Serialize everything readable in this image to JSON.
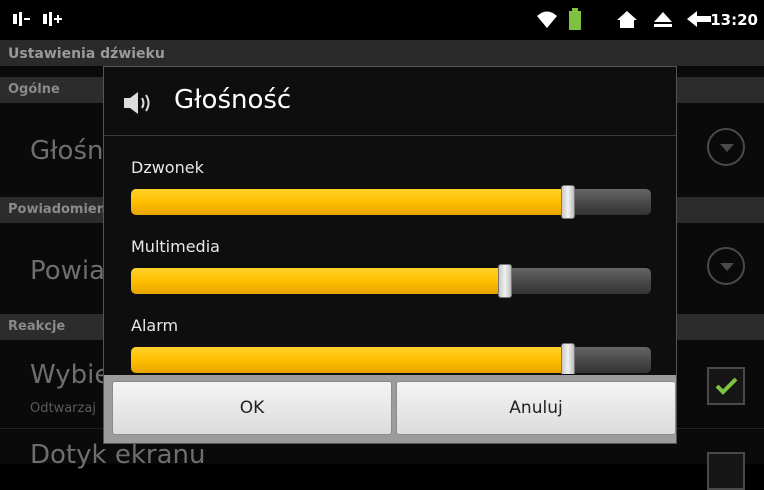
{
  "statusbar": {
    "time": "13:20"
  },
  "background": {
    "title": "Ustawienia dźwieku",
    "sections": [
      {
        "label": "Ogólne"
      },
      {
        "label": "Powiadomienia"
      },
      {
        "label": "Reakcje"
      }
    ],
    "items": [
      {
        "label": "Głośność"
      },
      {
        "label": "Powiadomienia"
      },
      {
        "label": "Wybieranie numeru",
        "sub": "Odtwarzaj"
      },
      {
        "label": "Dotyk ekranu"
      }
    ]
  },
  "dialog": {
    "title": "Głośność",
    "sliders": [
      {
        "label": "Dzwonek",
        "value": 0.84
      },
      {
        "label": "Multimedia",
        "value": 0.72
      },
      {
        "label": "Alarm",
        "value": 0.84
      }
    ],
    "ok_label": "OK",
    "cancel_label": "Anuluj"
  },
  "colors": {
    "accent": "#ffbf00",
    "check": "#7fc241"
  },
  "icons": [
    "signal-icon",
    "usb-icon",
    "wifi-icon",
    "battery-icon",
    "home-icon",
    "eject-icon",
    "back-icon",
    "speaker-icon",
    "chevron-down-icon",
    "checkmark-icon"
  ]
}
